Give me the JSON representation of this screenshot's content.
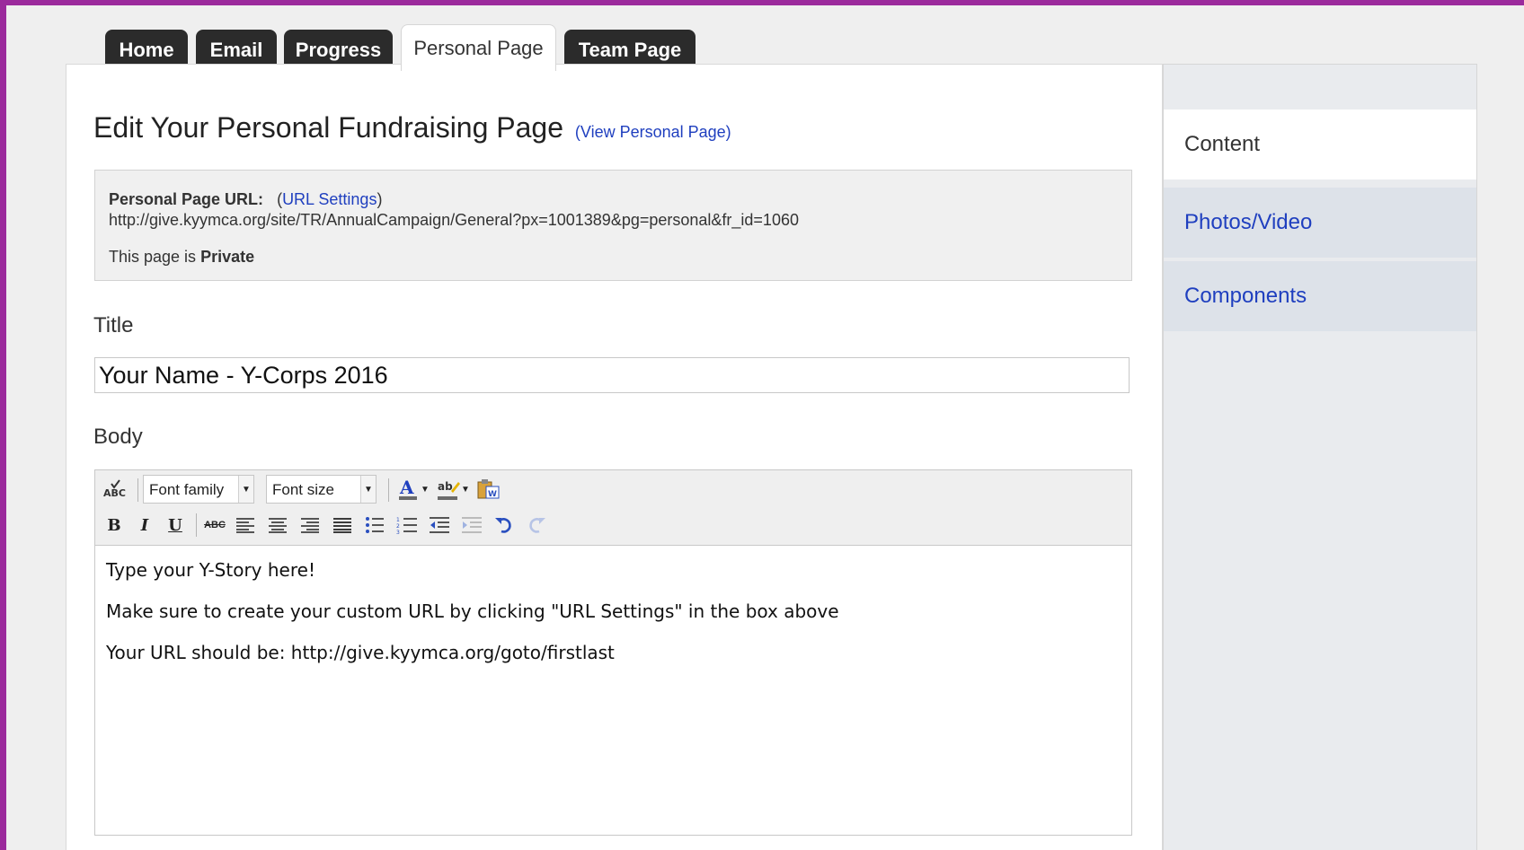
{
  "tabs": [
    {
      "label": "Home"
    },
    {
      "label": "Email"
    },
    {
      "label": "Progress"
    },
    {
      "label": "Personal Page"
    },
    {
      "label": "Team Page"
    }
  ],
  "active_tab": "Personal Page",
  "page": {
    "title": "Edit Your Personal Fundraising Page",
    "view_link": "(View Personal Page)"
  },
  "url_box": {
    "label": "Personal Page URL:",
    "settings_open": "(",
    "settings_link": "URL Settings",
    "settings_close": ")",
    "url": "http://give.kyymca.org/site/TR/AnnualCampaign/General?px=1001389&pg=personal&fr_id=1060",
    "privacy_prefix": "This page is",
    "privacy_value": "Private"
  },
  "title_field": {
    "label": "Title",
    "value": "Your Name - Y-Corps 2016"
  },
  "body_field": {
    "label": "Body",
    "font_family": "Font family",
    "font_size": "Font size",
    "paragraphs": [
      "Type your Y-Story here!",
      "Make sure to create your custom URL by clicking \"URL Settings\" in the box above",
      "Your URL should be: http://give.kyymca.org/goto/firstlast"
    ]
  },
  "sidebar": {
    "items": [
      {
        "label": "Content"
      },
      {
        "label": "Photos/Video"
      },
      {
        "label": "Components"
      }
    ]
  },
  "colors": {
    "accent_link": "#1f3fbf",
    "tab_dark": "#2b2b2b",
    "border": "#9b2a9c"
  }
}
